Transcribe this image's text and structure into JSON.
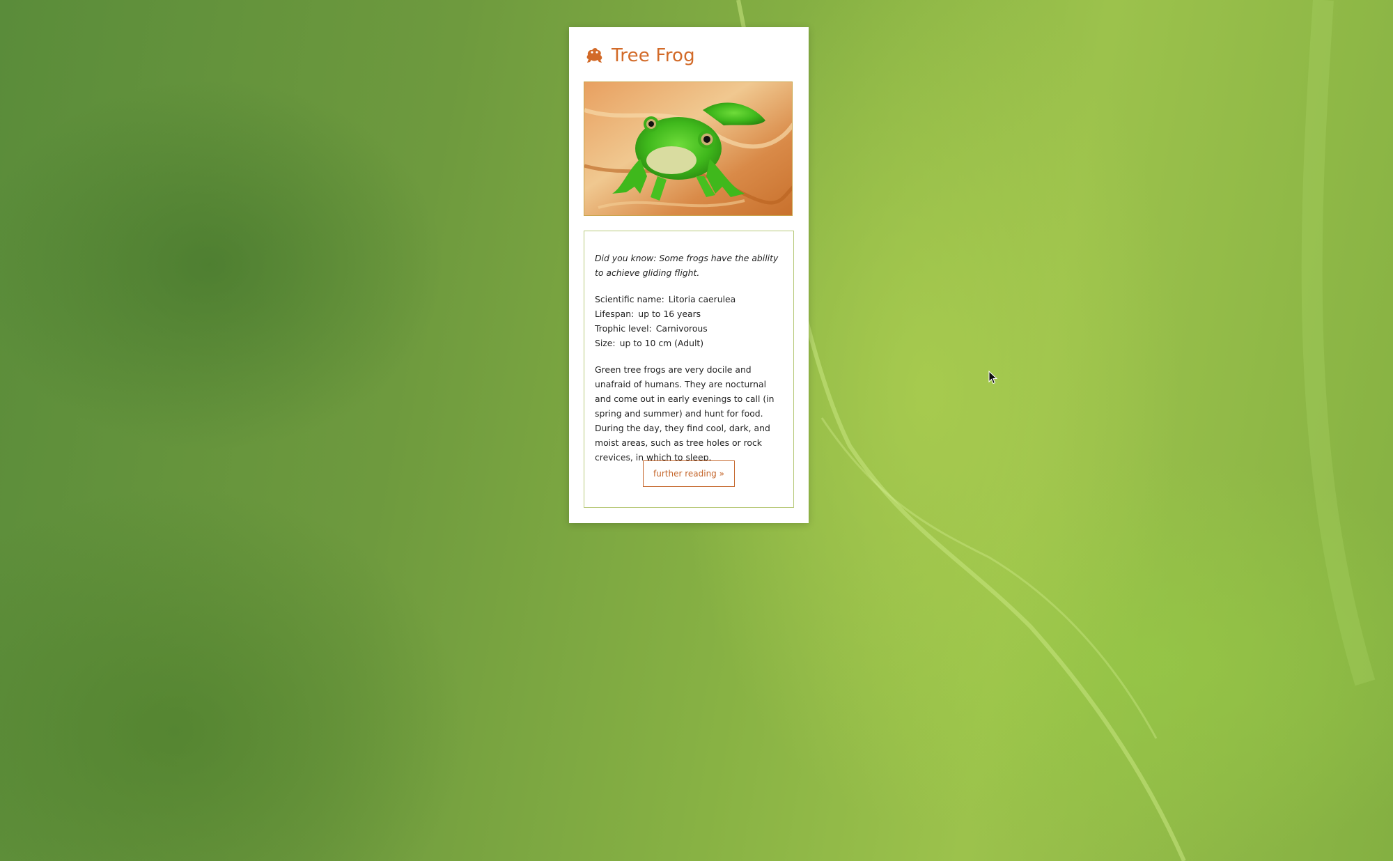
{
  "card": {
    "title": "Tree Frog",
    "icon": "frog-icon",
    "fact": "Did you know: Some frogs have the ability to achieve gliding flight.",
    "stats": [
      {
        "label": "Scientific name:",
        "value": "Litoria caerulea"
      },
      {
        "label": "Lifespan:",
        "value": "up to 16 years"
      },
      {
        "label": "Trophic level:",
        "value": "Carnivorous"
      },
      {
        "label": "Size:",
        "value": "up to 10 cm (Adult)"
      }
    ],
    "description": "Green tree frogs are very docile and unafraid of humans. They are nocturnal and come out in early evenings to call (in spring and summer) and hunt for food. During the day, they find cool, dark, and moist areas, such as tree holes or rock crevices, in which to sleep.",
    "button_label": "further reading »"
  },
  "colors": {
    "accent": "#d26a28",
    "box_border": "#b8c97a",
    "background": "#7fa843"
  }
}
